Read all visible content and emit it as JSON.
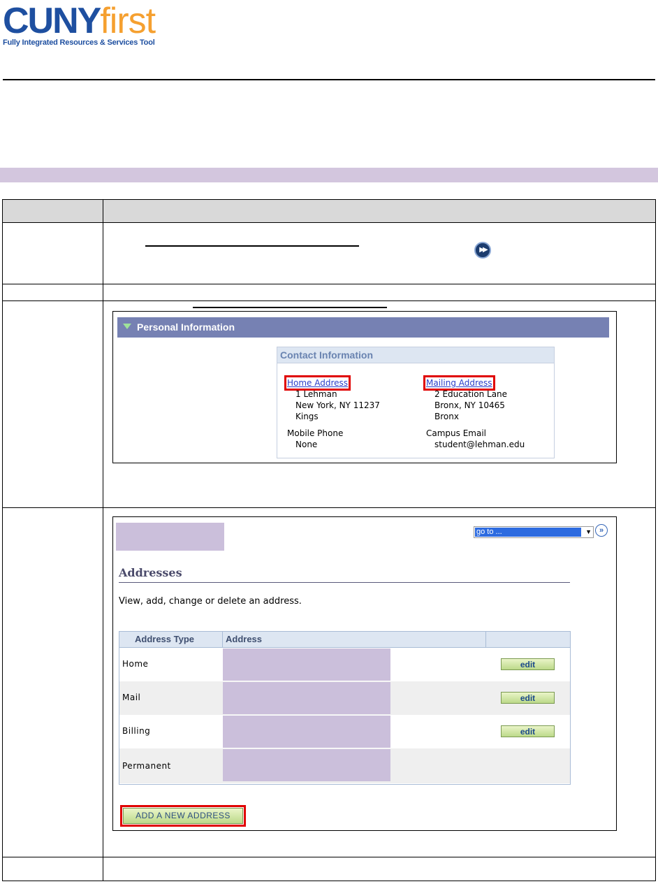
{
  "logo": {
    "brand_main": "CUNY",
    "brand_accent": "first",
    "tagline": "Fully Integrated Resources & Services Tool"
  },
  "personal_info": {
    "section_title": "Personal Information",
    "contact_header": "Contact Information",
    "home_link": "Home Address",
    "home_line1": "1 Lehman",
    "home_line2": "New York, NY 11237",
    "home_line3": "Kings",
    "mailing_link": "Mailing Address",
    "mailing_line1": "2 Education Lane",
    "mailing_line2": "Bronx, NY 10465",
    "mailing_line3": "Bronx",
    "mobile_label": "Mobile Phone",
    "mobile_value": "None",
    "email_label": "Campus Email",
    "email_value": "student@lehman.edu"
  },
  "addresses": {
    "goto_value": "go to ...",
    "title": "Addresses",
    "description": "View, add, change or delete an address.",
    "col_type": "Address Type",
    "col_address": "Address",
    "rows": [
      {
        "type": "Home",
        "edit": "edit"
      },
      {
        "type": "Mail",
        "edit": "edit"
      },
      {
        "type": "Billing",
        "edit": "edit"
      },
      {
        "type": "Permanent"
      }
    ],
    "add_button": "ADD A NEW ADDRESS"
  }
}
